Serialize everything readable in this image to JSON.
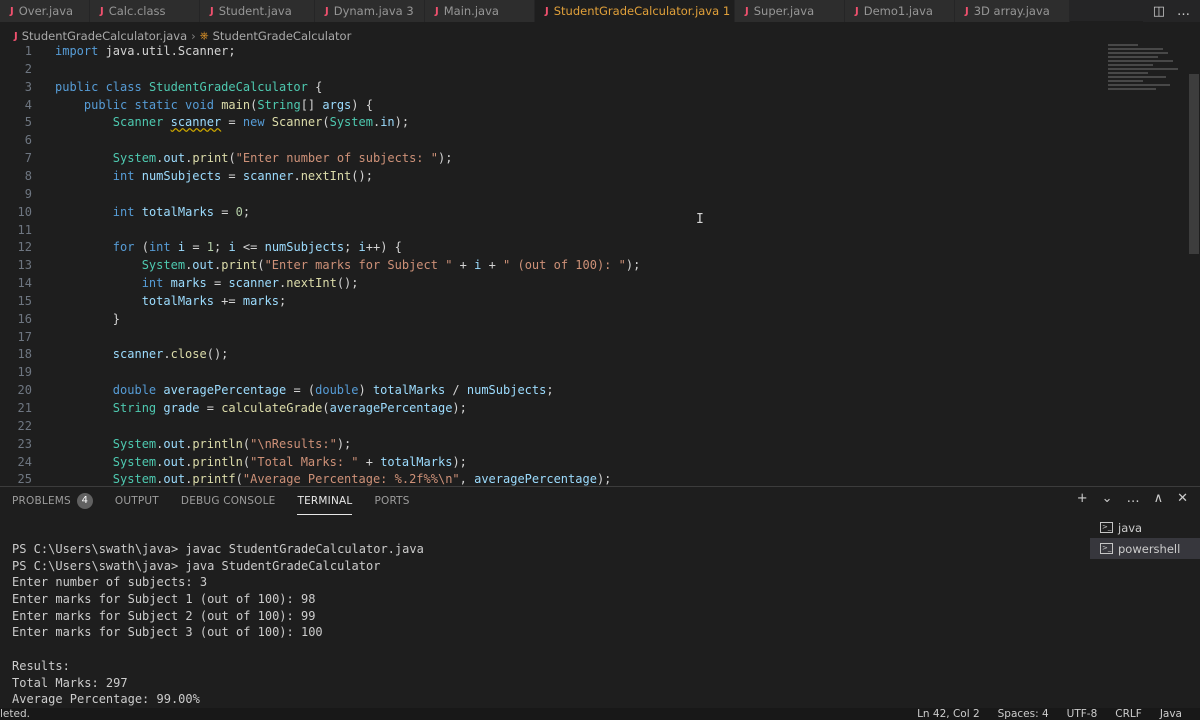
{
  "tabs": [
    {
      "label": "Over.java",
      "width": 90
    },
    {
      "label": "Calc.class",
      "width": 110
    },
    {
      "label": "Student.java",
      "width": 115
    },
    {
      "label": "Dynam.java 3",
      "width": 110
    },
    {
      "label": "Main.java",
      "width": 110
    },
    {
      "label": "StudentGradeCalculator.java 1",
      "width": 200,
      "active": true
    },
    {
      "label": "Super.java",
      "width": 110
    },
    {
      "label": "Demo1.java",
      "width": 110
    },
    {
      "label": "3D array.java",
      "width": 115
    }
  ],
  "tab_close_glyph": "✕",
  "tab_more_glyph": "…",
  "tab_split_glyph": "◫",
  "breadcrumb": {
    "file": "StudentGradeCalculator.java",
    "symbol": "StudentGradeCalculator",
    "symbol_icon": "⎈"
  },
  "code": [
    {
      "n": "1",
      "html": "<span class=\"kw\">import</span> java.util.Scanner;"
    },
    {
      "n": "2",
      "html": ""
    },
    {
      "n": "3",
      "html": "<span class=\"kw\">public class</span> <span class=\"ty\">StudentGradeCalculator</span> {"
    },
    {
      "n": "4",
      "html": "    <span class=\"kw\">public static void</span> <span class=\"fn\">main</span>(<span class=\"ty\">String</span>[] <span class=\"var\">args</span>) {"
    },
    {
      "n": "5",
      "html": "        <span class=\"ty\">Scanner</span> <span class=\"var squig\">scanner</span> = <span class=\"kw\">new</span> <span class=\"fn\">Scanner</span>(<span class=\"ty\">System</span>.<span class=\"var\">in</span>);"
    },
    {
      "n": "6",
      "html": ""
    },
    {
      "n": "7",
      "html": "        <span class=\"ty\">System</span>.<span class=\"var\">out</span>.<span class=\"fn\">print</span>(<span class=\"str\">\"Enter number of subjects: \"</span>);"
    },
    {
      "n": "8",
      "html": "        <span class=\"kw\">int</span> <span class=\"var\">numSubjects</span> = <span class=\"var\">scanner</span>.<span class=\"fn\">nextInt</span>();"
    },
    {
      "n": "9",
      "html": ""
    },
    {
      "n": "10",
      "html": "        <span class=\"kw\">int</span> <span class=\"var\">totalMarks</span> = <span class=\"num\">0</span>;"
    },
    {
      "n": "11",
      "html": ""
    },
    {
      "n": "12",
      "html": "        <span class=\"kw\">for</span> (<span class=\"kw\">int</span> <span class=\"var\">i</span> = <span class=\"num\">1</span>; <span class=\"var\">i</span> &lt;= <span class=\"var\">numSubjects</span>; <span class=\"var\">i</span>++) {"
    },
    {
      "n": "13",
      "html": "            <span class=\"ty\">System</span>.<span class=\"var\">out</span>.<span class=\"fn\">print</span>(<span class=\"str\">\"Enter marks for Subject \"</span> + <span class=\"var\">i</span> + <span class=\"str\">\" (out of 100): \"</span>);"
    },
    {
      "n": "14",
      "html": "            <span class=\"kw\">int</span> <span class=\"var\">marks</span> = <span class=\"var\">scanner</span>.<span class=\"fn\">nextInt</span>();"
    },
    {
      "n": "15",
      "html": "            <span class=\"var\">totalMarks</span> += <span class=\"var\">marks</span>;"
    },
    {
      "n": "16",
      "html": "        }"
    },
    {
      "n": "17",
      "html": ""
    },
    {
      "n": "18",
      "html": "        <span class=\"var\">scanner</span>.<span class=\"fn\">close</span>();"
    },
    {
      "n": "19",
      "html": ""
    },
    {
      "n": "20",
      "html": "        <span class=\"kw\">double</span> <span class=\"var\">averagePercentage</span> = (<span class=\"kw\">double</span>) <span class=\"var\">totalMarks</span> / <span class=\"var\">numSubjects</span>;"
    },
    {
      "n": "21",
      "html": "        <span class=\"ty\">String</span> <span class=\"var\">grade</span> = <span class=\"fn\">calculateGrade</span>(<span class=\"var\">averagePercentage</span>);"
    },
    {
      "n": "22",
      "html": ""
    },
    {
      "n": "23",
      "html": "        <span class=\"ty\">System</span>.<span class=\"var\">out</span>.<span class=\"fn\">println</span>(<span class=\"str\">\"\\nResults:\"</span>);"
    },
    {
      "n": "24",
      "html": "        <span class=\"ty\">System</span>.<span class=\"var\">out</span>.<span class=\"fn\">println</span>(<span class=\"str\">\"Total Marks: \"</span> + <span class=\"var\">totalMarks</span>);"
    },
    {
      "n": "25",
      "html": "        <span class=\"ty\">System</span>.<span class=\"var\">out</span>.<span class=\"fn\">printf</span>(<span class=\"str\">\"Average Percentage: %.2f%%\\n\"</span>, <span class=\"var\">averagePercentage</span>);"
    }
  ],
  "panel": {
    "tabs": [
      {
        "label": "PROBLEMS",
        "badge": "4"
      },
      {
        "label": "OUTPUT"
      },
      {
        "label": "DEBUG CONSOLE"
      },
      {
        "label": "TERMINAL",
        "active": true
      },
      {
        "label": "PORTS"
      }
    ],
    "actions": [
      "+",
      "⌄",
      "…",
      "∧",
      "✕"
    ]
  },
  "terminal_lines": [
    "PS C:\\Users\\swath\\java> javac StudentGradeCalculator.java",
    "PS C:\\Users\\swath\\java> java StudentGradeCalculator",
    "Enter number of subjects: 3",
    "Enter marks for Subject 1 (out of 100): 98",
    "Enter marks for Subject 2 (out of 100): 99",
    "Enter marks for Subject 3 (out of 100): 100",
    "",
    "Results:",
    "Total Marks: 297",
    "Average Percentage: 99.00%"
  ],
  "terminal_list": [
    {
      "label": "java"
    },
    {
      "label": "powershell",
      "active": true
    }
  ],
  "terminal_icon_glyph": ">_",
  "statusbar": {
    "left": "leted.",
    "ln_col": "Ln 42, Col 2",
    "spaces": "Spaces: 4",
    "encoding": "UTF-8",
    "eol": "CRLF",
    "language": "Java"
  },
  "ibeam_glyph": "I"
}
